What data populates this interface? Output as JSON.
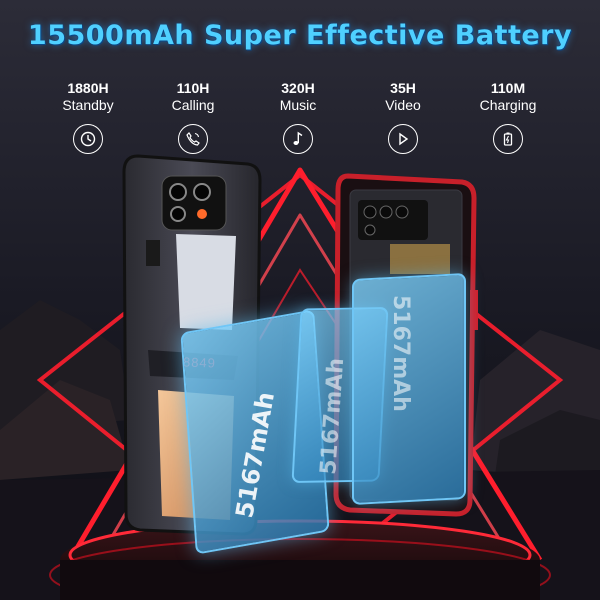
{
  "headline": "15500mAh Super Effective Battery",
  "stats": [
    {
      "value": "1880H",
      "label": "Standby",
      "icon": "clock-icon"
    },
    {
      "value": "110H",
      "label": "Calling",
      "icon": "phone-call-icon"
    },
    {
      "value": "320H",
      "label": "Music",
      "icon": "music-note-icon"
    },
    {
      "value": "35H",
      "label": "Video",
      "icon": "play-icon"
    },
    {
      "value": "110M",
      "label": "Charging",
      "icon": "battery-charging-icon"
    }
  ],
  "phone_brand": "8849",
  "battery_cells": [
    {
      "capacity": "5167mAh"
    },
    {
      "capacity": "5167mAh"
    },
    {
      "capacity": "5167mAh"
    }
  ],
  "colors": {
    "headline": "#4fd0ff",
    "neon": "#ff1e2d",
    "battery": "#5ab8e8"
  }
}
